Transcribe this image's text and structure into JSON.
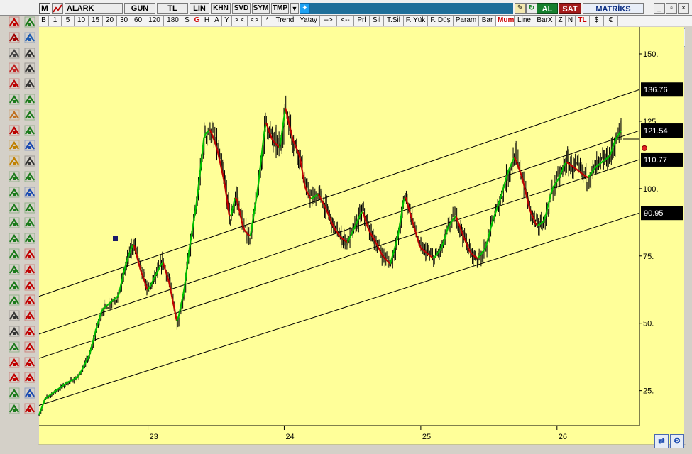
{
  "titlebar": {
    "logo": "M",
    "symbol": "ALARK",
    "period": "GUN",
    "currency": "TL",
    "scale": "LIN",
    "khn": "KHN",
    "svd": "SVD",
    "sym": "SYM",
    "tmp": "TMP",
    "buy": "AL",
    "sell": "SAT",
    "brand": "MATRİKS",
    "minimize": "_",
    "restore": "▫",
    "close": "×"
  },
  "toolbar": [
    "B",
    "1",
    "5",
    "10",
    "15",
    "20",
    "30",
    "60",
    "120",
    "180",
    "S",
    "G",
    "H",
    "A",
    "Y",
    "> <",
    "<>",
    "*",
    "Trend",
    "Yatay",
    "-->",
    "<--",
    "Prl",
    "Sil",
    "T.Sil",
    "F. Yük",
    "F. Düş",
    "Param",
    "Bar",
    "Mum",
    "Line",
    "BarX",
    "Z",
    "N",
    "TL",
    "$",
    "€"
  ],
  "colors": {
    "plot_bg": "#ffff99",
    "up": "#00c000",
    "down": "#c00000",
    "bar": "#000000",
    "line": "#000000",
    "label_bg": "#000000",
    "label_fg": "#ffffff",
    "toolbar_active": "#cc0000"
  },
  "chart_data": {
    "type": "candlestick",
    "title": "",
    "x_ticks": [
      "23",
      "24",
      "25",
      "26"
    ],
    "x_range": [
      "2022-03-15",
      "2026-08-10"
    ],
    "ylim": [
      12,
      160
    ],
    "y_ticks": [
      25,
      50,
      75,
      100,
      125,
      150
    ],
    "y_tick_labels": [
      "25.",
      "50.",
      "75.",
      "100.",
      "125.",
      "150."
    ],
    "price_labels": [
      "136.76",
      "121.54",
      "110.77",
      "90.95"
    ],
    "last_price": 121.54,
    "channel": {
      "start": "2022-03-15",
      "end": "2026-08-10",
      "lines": [
        {
          "name": "upper",
          "y_start": 60.0,
          "y_end": 136.76
        },
        {
          "name": "upper-mid",
          "y_start": 46.0,
          "y_end": 121.54
        },
        {
          "name": "lower-mid",
          "y_start": 37.0,
          "y_end": 110.77
        },
        {
          "name": "lower",
          "y_start": 19.5,
          "y_end": 90.95
        }
      ]
    },
    "series": [
      {
        "x": [
          "2022-03-15",
          "2022-04-01",
          "2022-05-01",
          "2022-06-01",
          "2022-07-01",
          "2022-08-01",
          "2022-08-20",
          "2022-09-05",
          "2022-10-01",
          "2022-10-20",
          "2022-11-10",
          "2022-12-01",
          "2022-12-20",
          "2023-01-10",
          "2023-02-01",
          "2023-02-20",
          "2023-03-10",
          "2023-04-01",
          "2023-04-20",
          "2023-05-05",
          "2023-05-25",
          "2023-06-15",
          "2023-07-01",
          "2023-07-20",
          "2023-08-10",
          "2023-08-25",
          "2023-09-10",
          "2023-10-01",
          "2023-10-20",
          "2023-11-10",
          "2023-12-01",
          "2023-12-20",
          "2024-01-10",
          "2024-01-25",
          "2024-02-15",
          "2024-03-05",
          "2024-03-20",
          "2024-04-05",
          "2024-04-25",
          "2024-05-15",
          "2024-06-05",
          "2024-06-25",
          "2024-07-15",
          "2024-08-05",
          "2024-08-25",
          "2024-09-10",
          "2024-10-01",
          "2024-10-20",
          "2024-11-10",
          "2024-12-01",
          "2024-12-20",
          "2025-01-10",
          "2025-02-01",
          "2025-02-20",
          "2025-03-10",
          "2025-04-01",
          "2025-04-20",
          "2025-05-10",
          "2025-06-01",
          "2025-06-20",
          "2025-07-10",
          "2025-08-01",
          "2025-08-20",
          "2025-09-10",
          "2025-10-01",
          "2025-10-20",
          "2025-11-10",
          "2025-12-01",
          "2025-12-20",
          "2026-01-10",
          "2026-02-01",
          "2026-02-20",
          "2026-03-10",
          "2026-04-01",
          "2026-04-20",
          "2026-05-10",
          "2026-06-01",
          "2026-06-20",
          "2026-07-10",
          "2026-07-25",
          "2026-08-10"
        ],
        "values": [
          16,
          22,
          25,
          28,
          30,
          38,
          48,
          55,
          58,
          60,
          72,
          80,
          70,
          62,
          68,
          73,
          65,
          50,
          62,
          78,
          95,
          120,
          122,
          115,
          102,
          88,
          98,
          85,
          82,
          100,
          125,
          118,
          115,
          130,
          118,
          112,
          100,
          96,
          98,
          93,
          86,
          82,
          80,
          86,
          92,
          85,
          80,
          75,
          72,
          82,
          98,
          88,
          78,
          76,
          74,
          78,
          86,
          90,
          82,
          76,
          74,
          78,
          88,
          96,
          106,
          112,
          104,
          92,
          86,
          88,
          100,
          104,
          110,
          108,
          106,
          104,
          108,
          110,
          112,
          118,
          121.54
        ]
      }
    ]
  }
}
